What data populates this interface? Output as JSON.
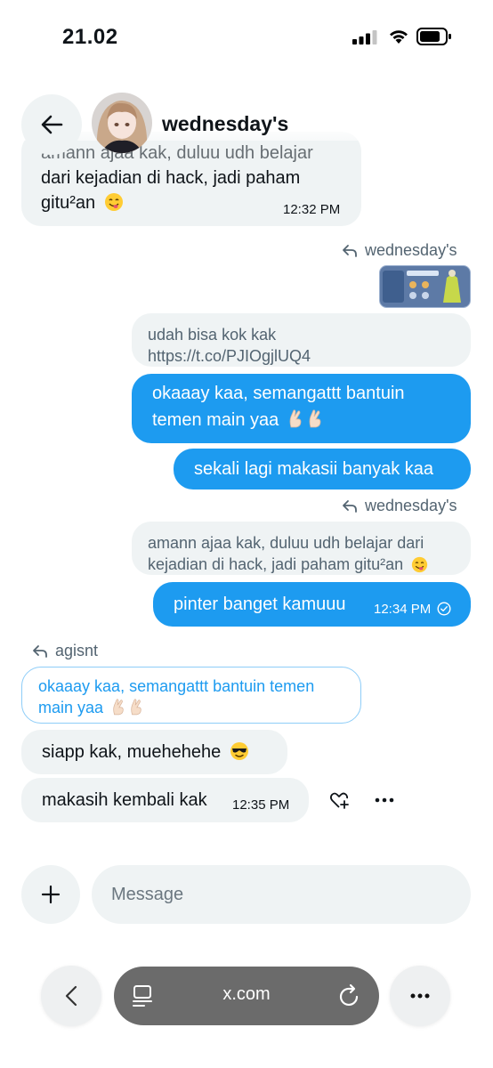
{
  "status_bar": {
    "time": "21.02"
  },
  "header": {
    "name": "wednesday's"
  },
  "messages": {
    "m1_partial": "amann ajaa kak, duluu udh belajar",
    "m1_line2": "dari kejadian di hack, jadi paham",
    "m1_line3": "gitu²an",
    "m1_time": "12:32 PM",
    "reply_wed_1": "wednesday's",
    "quote_1_line1": "udah bisa kok kak",
    "quote_1_line2": "https://t.co/PJIOgjlUQ4",
    "out_1_line1": "okaaay kaa, semangattt bantuin",
    "out_1_line2": "temen main yaa",
    "out_2": "sekali lagi makasii banyak kaa",
    "reply_wed_2": "wednesday's",
    "quote_2_line1": "amann ajaa kak, duluu udh belajar dari",
    "quote_2_line2": "kejadian di hack, jadi paham gitu²an",
    "out_3": "pinter banget kamuuu",
    "out_3_time": "12:34 PM",
    "reply_agisnt": "agisnt",
    "quote_3_line1": "okaaay kaa, semangattt bantuin temen",
    "quote_3_line2": "main yaa",
    "in_2": "siapp kak, muehehehe",
    "in_3": "makasih kembali kak",
    "in_3_time": "12:35 PM"
  },
  "composer": {
    "placeholder": "Message"
  },
  "browser": {
    "url": "x.com"
  },
  "colors": {
    "accent": "#1d9bf0",
    "bubble_grey": "#eff3f4",
    "muted_text": "#536471"
  },
  "icons": [
    "back-arrow-icon",
    "reply-icon",
    "heart-plus-icon",
    "more-icon",
    "plus-icon",
    "read-receipt-icon",
    "reader-icon",
    "reload-icon",
    "chevron-left-icon"
  ]
}
